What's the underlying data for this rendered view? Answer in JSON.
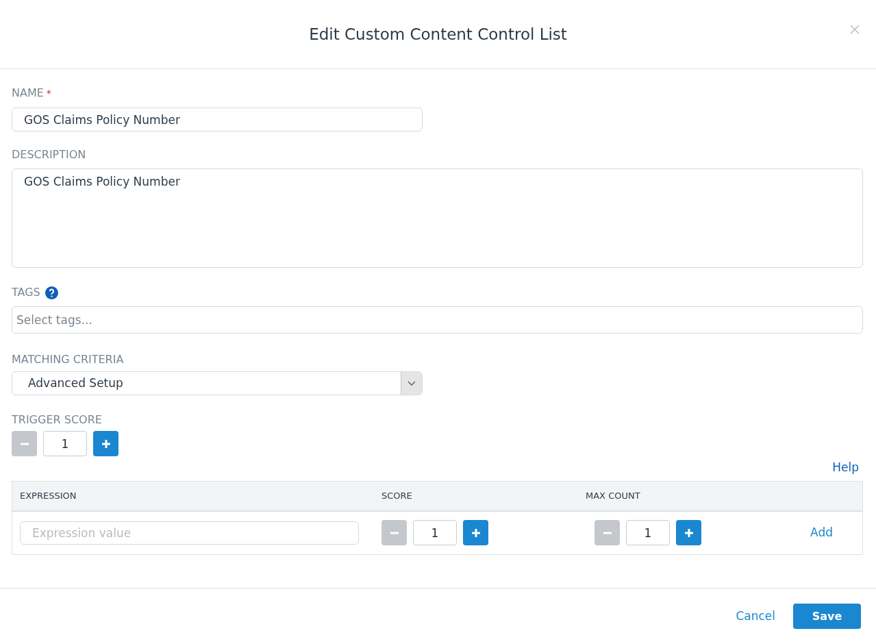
{
  "dialog": {
    "title": "Edit Custom Content Control List"
  },
  "name_field": {
    "label": "NAME",
    "required_mark": "*",
    "value": "GOS Claims Policy Number"
  },
  "description_field": {
    "label": "DESCRIPTION",
    "value": "GOS Claims Policy Number"
  },
  "tags_field": {
    "label": "TAGS",
    "placeholder": "Select tags..."
  },
  "matching_criteria": {
    "label": "MATCHING CRITERIA",
    "value": "Advanced Setup"
  },
  "trigger_score": {
    "label": "TRIGGER SCORE",
    "value": "1",
    "minus_disabled": true
  },
  "help_link": "Help",
  "table": {
    "columns": [
      "EXPRESSION",
      "SCORE",
      "MAX COUNT"
    ],
    "row": {
      "expression_placeholder": "Expression value",
      "score": {
        "value": "1",
        "minus_disabled": true
      },
      "max_count": {
        "value": "1",
        "minus_disabled": true
      },
      "add_link": "Add"
    }
  },
  "footer": {
    "buttons": [
      {
        "label": "Cancel",
        "kind": "link"
      },
      {
        "label": "Save",
        "kind": "primary"
      }
    ]
  }
}
